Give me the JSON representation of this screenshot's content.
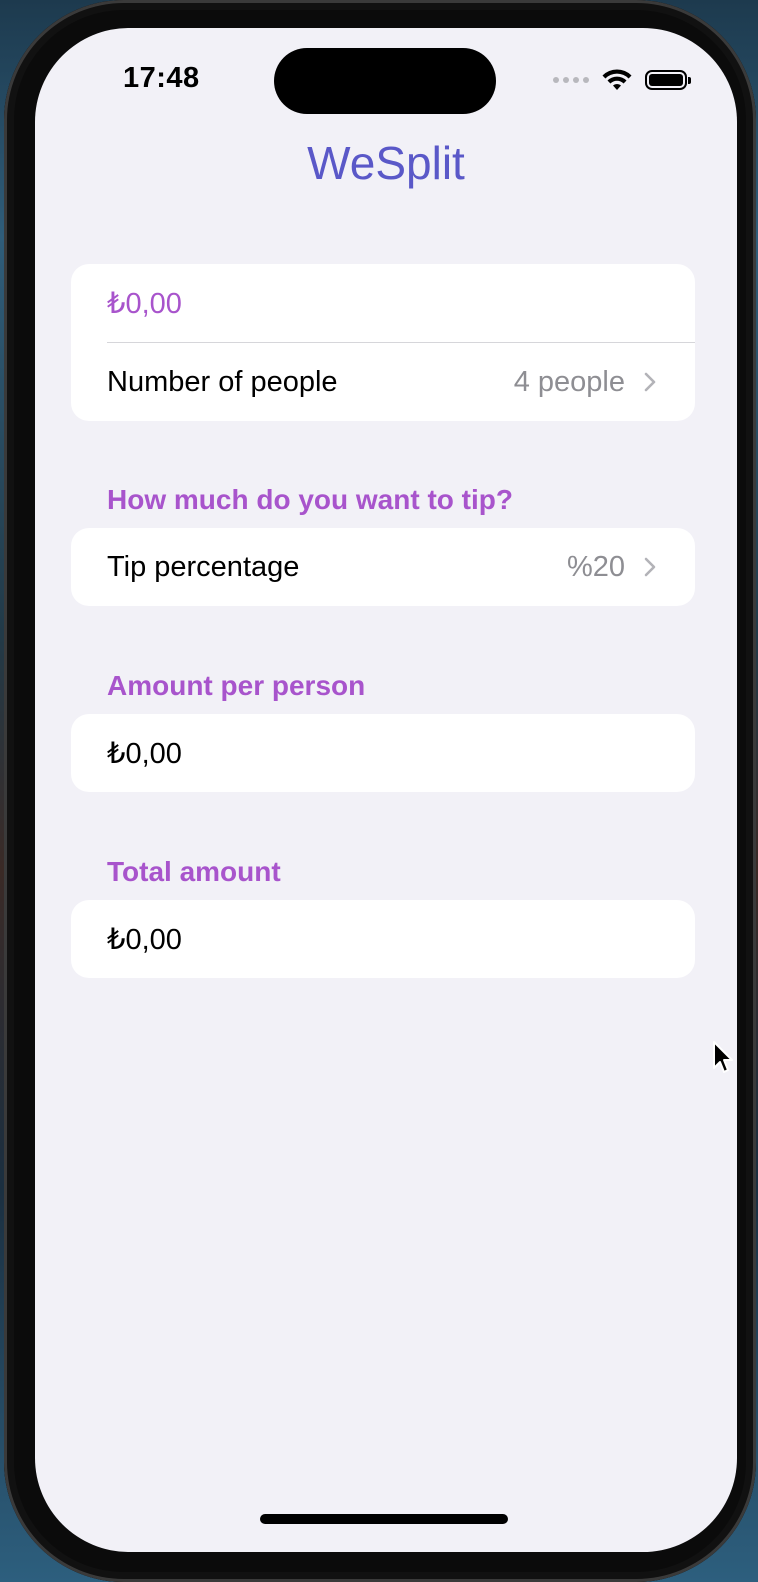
{
  "status_bar": {
    "time": "17:48",
    "icons": [
      "cellular-dots-icon",
      "wifi-icon",
      "battery-icon"
    ]
  },
  "nav": {
    "title": "WeSplit"
  },
  "input_section": {
    "amount_value": "₺0,00",
    "people_label": "Number of people",
    "people_value": "4 people"
  },
  "tip_section": {
    "header": "How much do you want to tip?",
    "tip_label": "Tip percentage",
    "tip_value": "%20"
  },
  "per_person_section": {
    "header": "Amount per person",
    "value": "₺0,00"
  },
  "total_section": {
    "header": "Total amount",
    "value": "₺0,00"
  },
  "colors": {
    "title": "#5a58c8",
    "accent": "#a854cc",
    "background": "#f2f1f7",
    "secondary_text": "#8e8e93"
  }
}
